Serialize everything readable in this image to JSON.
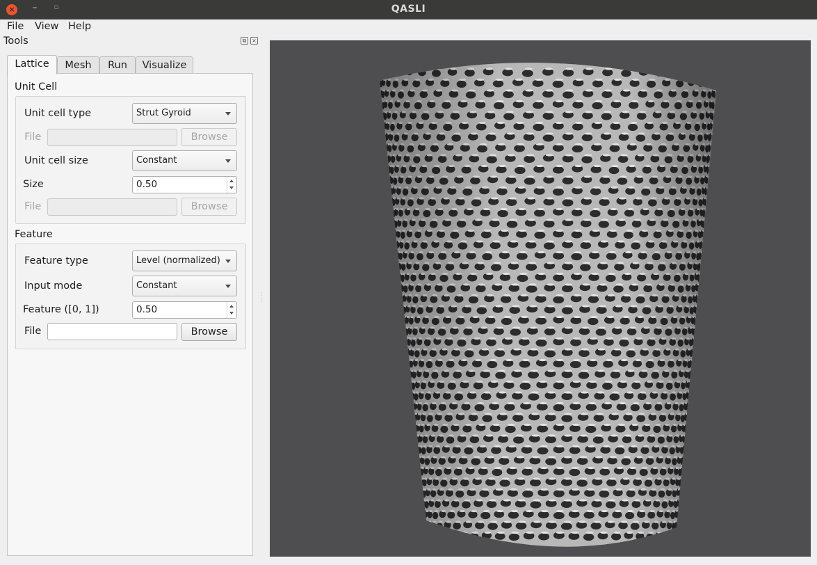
{
  "window": {
    "title": "QASLI",
    "close_glyph": "×",
    "minimize_glyph": "–",
    "maximize_glyph": "▫"
  },
  "menu": [
    "File",
    "View",
    "Help"
  ],
  "dock": {
    "title": "Tools",
    "float_glyph": "⧉",
    "close_glyph": "×"
  },
  "tabs": [
    "Lattice",
    "Mesh",
    "Run",
    "Visualize"
  ],
  "active_tab": "Lattice",
  "unit_cell": {
    "group_label": "Unit Cell",
    "type_label": "Unit cell type",
    "type_value": "Strut Gyroid",
    "file1_label": "File",
    "file1_value": "",
    "browse1_label": "Browse",
    "size_mode_label": "Unit cell size",
    "size_mode_value": "Constant",
    "size_label": "Size",
    "size_value": "0.50",
    "file2_label": "File",
    "file2_value": "",
    "browse2_label": "Browse"
  },
  "feature": {
    "group_label": "Feature",
    "type_label": "Feature type",
    "type_value": "Level (normalized)",
    "input_mode_label": "Input mode",
    "input_mode_value": "Constant",
    "value_label": "Feature ([0, 1])",
    "value": "0.50",
    "file_label": "File",
    "file_value": "",
    "browse_label": "Browse"
  },
  "viewport": {
    "background_color": "#4e4e50",
    "model_color": "#b8b8b8",
    "shadow_color": "#2c2c2c",
    "model": "strut-gyroid-lattice-cylinder"
  }
}
